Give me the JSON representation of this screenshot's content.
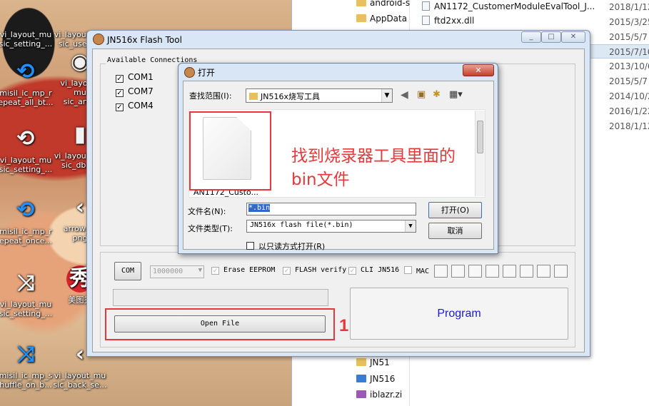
{
  "desktop": {
    "icons": [
      {
        "label": "vi_layout_mu\nsic_setting_...",
        "glyph": "",
        "color": "white"
      },
      {
        "label": "vi_layout_mu\nsic_user_...",
        "glyph": "",
        "color": "white"
      },
      {
        "label": "misil_ic_mp_r\nepeat_all_bt...",
        "glyph": "⟲",
        "color": "blue"
      },
      {
        "label": "vi_layout_\nmu\nsic_art...",
        "glyph": "◉",
        "color": "white"
      },
      {
        "label": "vi_layout_mu\nsic_setting_...",
        "glyph": "⟲",
        "color": "white"
      },
      {
        "label": "vi_layout_mu\nsic_dbg...",
        "glyph": "▮",
        "color": "white"
      },
      {
        "label": "misil_ic_mp_r\nepeat_once...",
        "glyph": "⟲",
        "color": "blue"
      },
      {
        "label": "arrow_le\npng",
        "glyph": "‹",
        "color": "white"
      },
      {
        "label": "vi_layout_mu\nsic_setting_...",
        "glyph": "⤨",
        "color": "white"
      },
      {
        "label": "美图秀",
        "glyph": "秀",
        "color": "white"
      },
      {
        "label": "misil_ic_mp_s\nhuffle_on_b...",
        "glyph": "⤨",
        "color": "blue"
      },
      {
        "label": "vi_layout_mu\nsic_back_se...",
        "glyph": "‹",
        "color": "white"
      }
    ]
  },
  "explorer": {
    "tree": [
      "android-s",
      "AppData",
      "JN51",
      "JN516",
      "iblazr.zi"
    ],
    "files": [
      "AN1172_CustomerModuleEvalTool_J...",
      "ftd2xx.dll"
    ],
    "dates": [
      "2018/1/12",
      "2015/3/25",
      "2015/5/7",
      "2015/7/10",
      "2013/10/6",
      "2015/5/7",
      "2014/10/2",
      "2016/1/22",
      "2018/1/12"
    ]
  },
  "flash_tool": {
    "title": "JN516x Flash Tool",
    "connections_label": "Available Connections",
    "connections": [
      "COM1",
      "COM7",
      "COM4"
    ],
    "com_button": "COM",
    "baud": "1000000",
    "erase_eeprom": "Erase EEPROM",
    "flash_verify": "FLASH verify",
    "cli_jn516": "CLI JN516",
    "mac": "MAC",
    "open_file_button": "Open File",
    "program_button": "Program"
  },
  "open_dialog": {
    "title": "打开",
    "look_in_label": "查找范围(I):",
    "look_in_value": "JN516x烧写工具",
    "file_item": "AN1172_Custo...",
    "filename_label": "文件名(N):",
    "filename_value": "*.bin",
    "filetype_label": "文件类型(T):",
    "filetype_value": "JN516x flash file(*.bin)",
    "readonly_label": "以只读方式打开(R)",
    "open_button": "打开(O)",
    "cancel_button": "取消"
  },
  "annotations": {
    "step_number": "1",
    "hint": "找到烧录器工具里面的\nbin文件"
  }
}
